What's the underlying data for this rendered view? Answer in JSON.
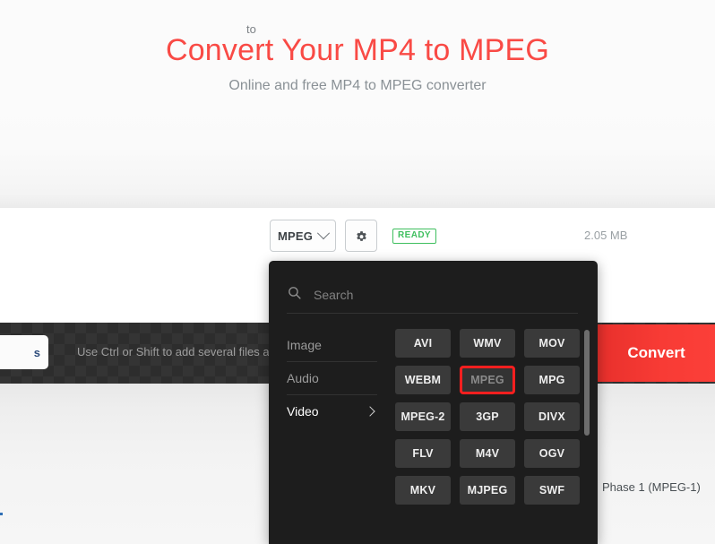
{
  "hero": {
    "title": "Convert Your MP4 to MPEG",
    "subtitle": "Online and free MP4 to MPEG converter"
  },
  "ad": {
    "close_icon": "close-icon",
    "close_label": "✕"
  },
  "toolbar": {
    "to_label": "to",
    "format_value": "MPEG",
    "chevron_icon": "chevron-down-icon",
    "settings_icon": "gear-icon",
    "status_badge": "READY",
    "file_size": "2.05 MB"
  },
  "file_strip": {
    "file_chip_label": "s",
    "hint": "Use Ctrl or Shift to add several files a",
    "convert_label": "Convert"
  },
  "lower": {
    "note": "Phase 1 (MPEG-1)"
  },
  "dropdown": {
    "search_placeholder": "Search",
    "search_value": "",
    "search_icon": "search-icon",
    "categories": [
      {
        "label": "Image",
        "active": false,
        "has_chevron": false
      },
      {
        "label": "Audio",
        "active": false,
        "has_chevron": false
      },
      {
        "label": "Video",
        "active": true,
        "has_chevron": true
      }
    ],
    "formats": [
      {
        "label": "AVI",
        "selected": false
      },
      {
        "label": "WMV",
        "selected": false
      },
      {
        "label": "MOV",
        "selected": false
      },
      {
        "label": "WEBM",
        "selected": false
      },
      {
        "label": "MPEG",
        "selected": true
      },
      {
        "label": "MPG",
        "selected": false
      },
      {
        "label": "MPEG-2",
        "selected": false
      },
      {
        "label": "3GP",
        "selected": false
      },
      {
        "label": "DIVX",
        "selected": false
      },
      {
        "label": "FLV",
        "selected": false
      },
      {
        "label": "M4V",
        "selected": false
      },
      {
        "label": "OGV",
        "selected": false
      },
      {
        "label": "MKV",
        "selected": false
      },
      {
        "label": "MJPEG",
        "selected": false
      },
      {
        "label": "SWF",
        "selected": false
      }
    ]
  },
  "colors": {
    "brand_red": "#f94a45",
    "convert_red": "#f83b35",
    "ready_green": "#3fbf5f",
    "ad_close_cyan": "#00b0d4",
    "selected_border": "#fa1f1f",
    "panel_bg": "#1d1d1d"
  }
}
